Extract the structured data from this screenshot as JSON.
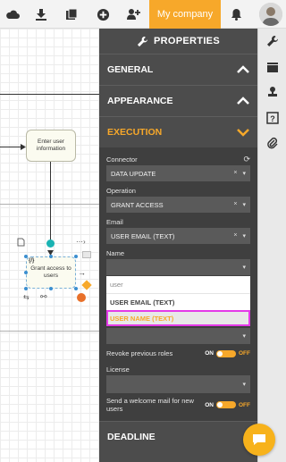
{
  "topbar": {
    "company_label": "My company",
    "icons": [
      "cloud-icon",
      "download-icon",
      "folder-icon",
      "add-circle-icon",
      "add-user-icon",
      "bell-icon"
    ]
  },
  "canvas": {
    "tasks": [
      {
        "label": "Enter user information"
      },
      {
        "label": "Grant access to users"
      }
    ]
  },
  "panel": {
    "title": "PROPERTIES",
    "sections": {
      "general": "GENERAL",
      "appearance": "APPEARANCE",
      "execution": "EXECUTION",
      "deadline": "DEADLINE"
    },
    "execution": {
      "connector_label": "Connector",
      "connector_value": "DATA UPDATE",
      "operation_label": "Operation",
      "operation_value": "GRANT ACCESS",
      "email_label": "Email",
      "email_value": "USER EMAIL (TEXT)",
      "name_label": "Name",
      "name_search_value": "user",
      "name_options": [
        "USER EMAIL (TEXT)",
        "USER NAME (TEXT)"
      ],
      "revoke_label": "Revoke previous roles",
      "revoke_on": "ON",
      "revoke_off": "OFF",
      "license_label": "License",
      "welcome_label": "Send a welcome mail for new users",
      "welcome_on": "ON",
      "welcome_off": "OFF"
    }
  },
  "colors": {
    "accent": "#f7a82a",
    "panel_bg": "#4c4c4c",
    "highlight_outline": "#e43ae8"
  }
}
